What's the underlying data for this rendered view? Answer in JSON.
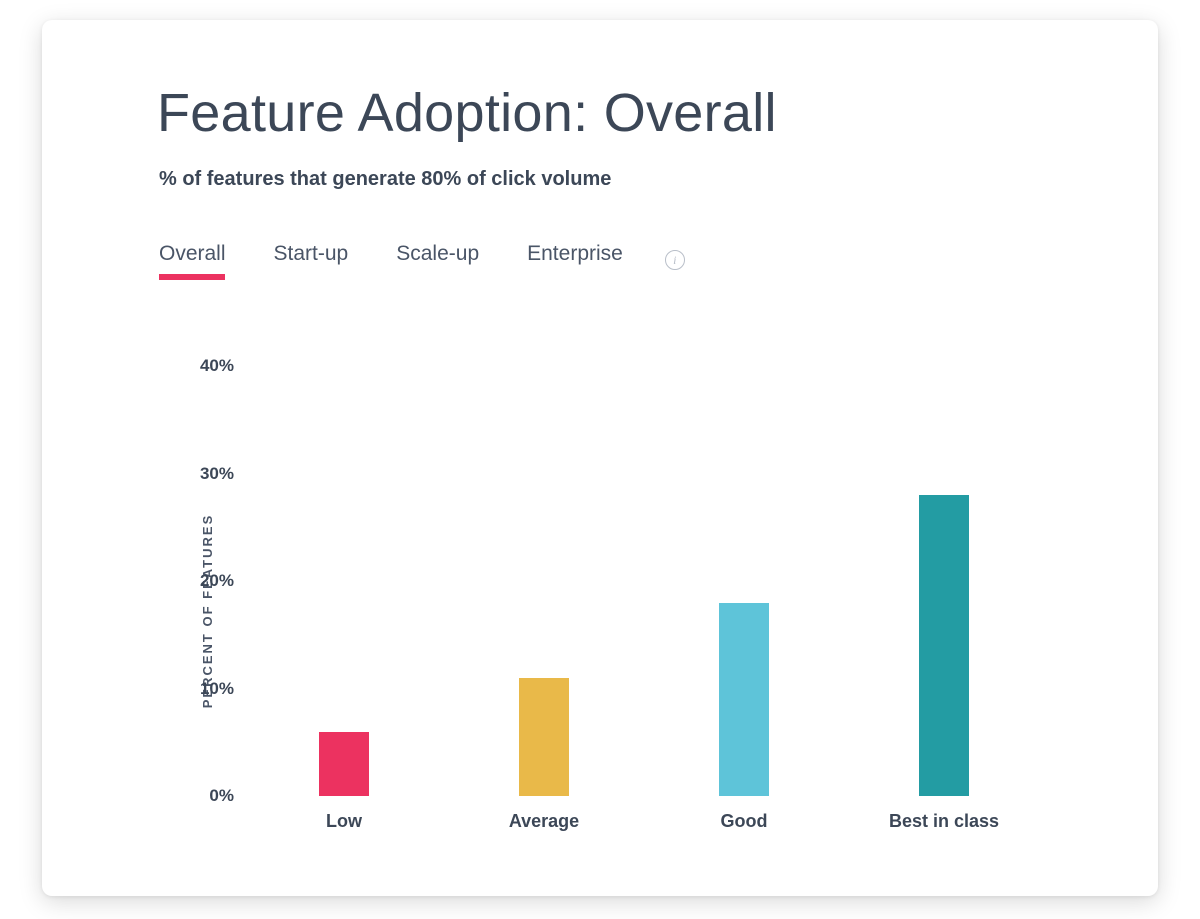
{
  "title": "Feature Adoption: Overall",
  "subtitle": "% of features that generate 80% of click volume",
  "tabs": [
    {
      "label": "Overall",
      "active": true
    },
    {
      "label": "Start-up",
      "active": false
    },
    {
      "label": "Scale-up",
      "active": false
    },
    {
      "label": "Enterprise",
      "active": false
    }
  ],
  "chart_data": {
    "type": "bar",
    "title": "Feature Adoption: Overall",
    "xlabel": "",
    "ylabel": "PERCENT OF FEATURES",
    "ylim": [
      0,
      40
    ],
    "yticks": [
      0,
      10,
      20,
      30,
      40
    ],
    "ytick_labels": [
      "0%",
      "10%",
      "20%",
      "30%",
      "40%"
    ],
    "categories": [
      "Low",
      "Average",
      "Good",
      "Best in class"
    ],
    "values": [
      6,
      11,
      18,
      28
    ],
    "colors": [
      "#ec3260",
      "#e9b949",
      "#5ec4d9",
      "#239ca3"
    ]
  }
}
